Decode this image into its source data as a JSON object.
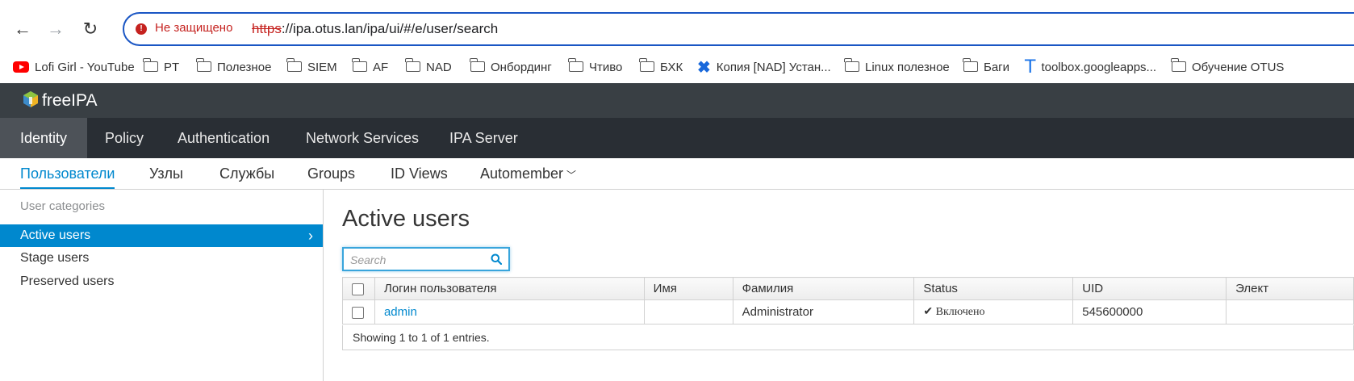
{
  "browser": {
    "insecure_label": "Не защищено",
    "url_scheme": "https",
    "url_rest": "://ipa.otus.lan/ipa/ui/#/e/user/search",
    "bookmarks": [
      {
        "label": "Lofi Girl - YouTube",
        "icon": "youtube-icon"
      },
      {
        "label": "PT",
        "icon": "folder-icon"
      },
      {
        "label": "Полезное",
        "icon": "folder-icon"
      },
      {
        "label": "SIEM",
        "icon": "folder-icon"
      },
      {
        "label": "AF",
        "icon": "folder-icon"
      },
      {
        "label": "NAD",
        "icon": "folder-icon"
      },
      {
        "label": "Онбординг",
        "icon": "folder-icon"
      },
      {
        "label": "Чтиво",
        "icon": "folder-icon"
      },
      {
        "label": "БХК",
        "icon": "folder-icon"
      },
      {
        "label": "Копия [NAD] Устан...",
        "icon": "confluence-icon"
      },
      {
        "label": "Linux полезное",
        "icon": "folder-icon"
      },
      {
        "label": "Баги",
        "icon": "folder-icon"
      },
      {
        "label": "toolbox.googleapps...",
        "icon": "toolbox-icon"
      },
      {
        "label": "Обучение OTUS",
        "icon": "folder-icon"
      }
    ]
  },
  "header": {
    "brand": "freeIPA"
  },
  "main_nav": [
    "Identity",
    "Policy",
    "Authentication",
    "Network Services",
    "IPA Server"
  ],
  "sub_nav": [
    "Пользователи",
    "Узлы",
    "Службы",
    "Groups",
    "ID Views",
    "Automember"
  ],
  "sidebar": {
    "title": "User categories",
    "items": [
      "Active users",
      "Stage users",
      "Preserved users"
    ]
  },
  "content": {
    "title": "Active users",
    "search_placeholder": "Search",
    "columns": [
      "Логин пользователя",
      "Имя",
      "Фамилия",
      "Status",
      "UID",
      "Элект"
    ],
    "rows": [
      {
        "login": "admin",
        "first": "",
        "last": "Administrator",
        "status": "Включено",
        "uid": "545600000",
        "email": ""
      }
    ],
    "footer": "Showing 1 to 1 of 1 entries."
  },
  "colors": {
    "accent": "#0088ce",
    "header": "#393f44",
    "nav": "#292e34",
    "insecure": "#c5221f"
  }
}
